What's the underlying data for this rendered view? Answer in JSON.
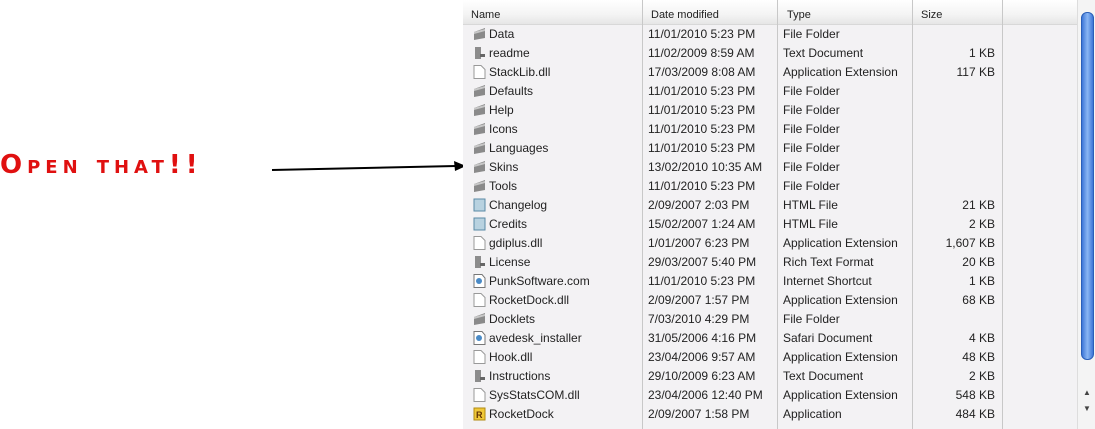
{
  "annotation": {
    "text": "Open that!!",
    "color": "#e01010"
  },
  "headers": {
    "name": "Name",
    "date": "Date modified",
    "type": "Type",
    "size": "Size"
  },
  "files": [
    {
      "name": "Data",
      "date": "11/01/2010 5:23 PM",
      "type": "File Folder",
      "size": "",
      "icon": "folder"
    },
    {
      "name": "readme",
      "date": "11/02/2009 8:59 AM",
      "type": "Text Document",
      "size": "1 KB",
      "icon": "text"
    },
    {
      "name": "StackLib.dll",
      "date": "17/03/2009 8:08 AM",
      "type": "Application Extension",
      "size": "117 KB",
      "icon": "file"
    },
    {
      "name": "Defaults",
      "date": "11/01/2010 5:23 PM",
      "type": "File Folder",
      "size": "",
      "icon": "folder"
    },
    {
      "name": "Help",
      "date": "11/01/2010 5:23 PM",
      "type": "File Folder",
      "size": "",
      "icon": "folder"
    },
    {
      "name": "Icons",
      "date": "11/01/2010 5:23 PM",
      "type": "File Folder",
      "size": "",
      "icon": "folder"
    },
    {
      "name": "Languages",
      "date": "11/01/2010 5:23 PM",
      "type": "File Folder",
      "size": "",
      "icon": "folder"
    },
    {
      "name": "Skins",
      "date": "13/02/2010 10:35 AM",
      "type": "File Folder",
      "size": "",
      "icon": "folder"
    },
    {
      "name": "Tools",
      "date": "11/01/2010 5:23 PM",
      "type": "File Folder",
      "size": "",
      "icon": "folder"
    },
    {
      "name": "Changelog",
      "date": "2/09/2007 2:03 PM",
      "type": "HTML File",
      "size": "21 KB",
      "icon": "html"
    },
    {
      "name": "Credits",
      "date": "15/02/2007 1:24 AM",
      "type": "HTML File",
      "size": "2 KB",
      "icon": "html"
    },
    {
      "name": "gdiplus.dll",
      "date": "1/01/2007 6:23 PM",
      "type": "Application Extension",
      "size": "1,607 KB",
      "icon": "file"
    },
    {
      "name": "License",
      "date": "29/03/2007 5:40 PM",
      "type": "Rich Text Format",
      "size": "20 KB",
      "icon": "text"
    },
    {
      "name": "PunkSoftware.com",
      "date": "11/01/2010 5:23 PM",
      "type": "Internet Shortcut",
      "size": "1 KB",
      "icon": "link"
    },
    {
      "name": "RocketDock.dll",
      "date": "2/09/2007 1:57 PM",
      "type": "Application Extension",
      "size": "68 KB",
      "icon": "file"
    },
    {
      "name": "Docklets",
      "date": "7/03/2010 4:29 PM",
      "type": "File Folder",
      "size": "",
      "icon": "folder"
    },
    {
      "name": "avedesk_installer",
      "date": "31/05/2006 4:16 PM",
      "type": "Safari Document",
      "size": "4 KB",
      "icon": "link"
    },
    {
      "name": "Hook.dll",
      "date": "23/04/2006 9:57 AM",
      "type": "Application Extension",
      "size": "48 KB",
      "icon": "file"
    },
    {
      "name": "Instructions",
      "date": "29/10/2009 6:23 AM",
      "type": "Text Document",
      "size": "2 KB",
      "icon": "text"
    },
    {
      "name": "SysStatsCOM.dll",
      "date": "23/04/2006 12:40 PM",
      "type": "Application Extension",
      "size": "548 KB",
      "icon": "file"
    },
    {
      "name": "RocketDock",
      "date": "2/09/2007 1:58 PM",
      "type": "Application",
      "size": "484 KB",
      "icon": "app"
    }
  ]
}
